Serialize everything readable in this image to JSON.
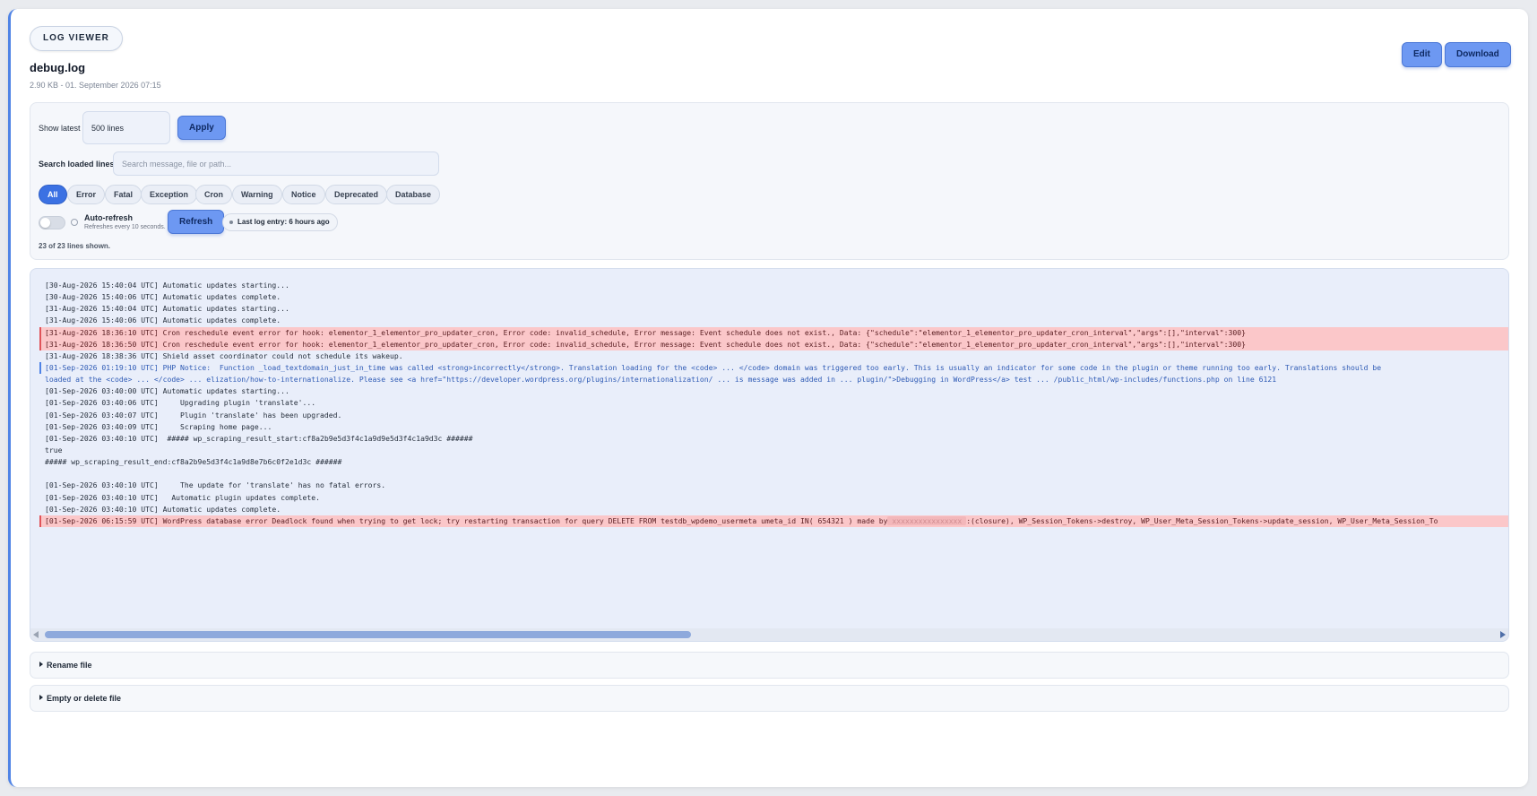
{
  "header": {
    "badge": "LOG VIEWER",
    "file_name": "debug.log",
    "file_meta": "2.90 KB - 01. September 2026 07:15",
    "edit_label": "Edit",
    "download_label": "Download"
  },
  "controls": {
    "show_latest_label": "Show latest",
    "lines_value": "500 lines",
    "apply_label": "Apply",
    "search_label": "Search loaded lines",
    "search_placeholder": "Search message, file or path...",
    "filters": [
      "All",
      "Error",
      "Fatal",
      "Exception",
      "Cron",
      "Warning",
      "Notice",
      "Deprecated",
      "Database"
    ],
    "active_filter": "All",
    "auto_refresh_label": "Auto-refresh",
    "auto_refresh_hint": "Refreshes every 10 seconds.",
    "auto_refresh_on": false,
    "refresh_label": "Refresh",
    "last_entry": "Last log entry: 6 hours ago",
    "shown_count": "23 of 23 lines shown."
  },
  "log": {
    "lines": [
      {
        "type": "normal",
        "text": "[30-Aug-2026 15:40:04 UTC] Automatic updates starting..."
      },
      {
        "type": "normal",
        "text": "[30-Aug-2026 15:40:06 UTC] Automatic updates complete."
      },
      {
        "type": "normal",
        "text": "[31-Aug-2026 15:40:04 UTC] Automatic updates starting..."
      },
      {
        "type": "normal",
        "text": "[31-Aug-2026 15:40:06 UTC] Automatic updates complete."
      },
      {
        "type": "err",
        "text": "[31-Aug-2026 18:36:10 UTC] Cron reschedule event error for hook: elementor_1_elementor_pro_updater_cron, Error code: invalid_schedule, Error message: Event schedule does not exist., Data: {\"schedule\":\"elementor_1_elementor_pro_updater_cron_interval\",\"args\":[],\"interval\":300}"
      },
      {
        "type": "err",
        "text": "[31-Aug-2026 18:36:50 UTC] Cron reschedule event error for hook: elementor_1_elementor_pro_updater_cron, Error code: invalid_schedule, Error message: Event schedule does not exist., Data: {\"schedule\":\"elementor_1_elementor_pro_updater_cron_interval\",\"args\":[],\"interval\":300}"
      },
      {
        "type": "normal",
        "text": "[31-Aug-2026 18:38:36 UTC] Shield asset coordinator could not schedule its wakeup."
      },
      {
        "type": "notice",
        "text": "[01-Sep-2026 01:19:10 UTC] PHP Notice:  Function _load_textdomain_just_in_time was called <strong>incorrectly</strong>. Translation loading for the <code> ... </code> domain was triggered too early. This is usually an indicator for some code in the plugin or theme running too early. Translations should be"
      },
      {
        "type": "notice-cont",
        "text": "loaded at the <code> ... </code> ... elization/how-to-internationalize. Please see <a href=\"https://developer.wordpress.org/plugins/internationalization/ ... is message was added in ... plugin/\">Debugging in WordPress</a> test ... /public_html/wp-includes/functions.php on line 6121"
      },
      {
        "type": "normal",
        "text": "[01-Sep-2026 03:40:00 UTC] Automatic updates starting..."
      },
      {
        "type": "normal",
        "text": "[01-Sep-2026 03:40:06 UTC]     Upgrading plugin 'translate'..."
      },
      {
        "type": "normal",
        "text": "[01-Sep-2026 03:40:07 UTC]     Plugin 'translate' has been upgraded."
      },
      {
        "type": "normal",
        "text": "[01-Sep-2026 03:40:09 UTC]     Scraping home page..."
      },
      {
        "type": "normal",
        "text": "[01-Sep-2026 03:40:10 UTC]  ##### wp_scraping_result_start:cf8a2b9e5d3f4c1a9d9e5d3f4c1a9d3c ######"
      },
      {
        "type": "normal",
        "text": "true"
      },
      {
        "type": "normal",
        "text": "##### wp_scraping_result_end:cf8a2b9e5d3f4c1a9d8e7b6c0f2e1d3c ######"
      },
      {
        "type": "normal",
        "text": ""
      },
      {
        "type": "normal",
        "text": "[01-Sep-2026 03:40:10 UTC]     The update for 'translate' has no fatal errors."
      },
      {
        "type": "normal",
        "text": "[01-Sep-2026 03:40:10 UTC]   Automatic plugin updates complete."
      },
      {
        "type": "normal",
        "text": "[01-Sep-2026 03:40:10 UTC] Automatic updates complete."
      },
      {
        "type": "err",
        "text": "[01-Sep-2026 06:15:59 UTC] WordPress database error Deadlock found when trying to get lock; try restarting transaction for query DELETE FROM testdb_wpdemo_usermeta umeta_id IN( 654321 ) made by",
        "redacted": true,
        "tail": ":(closure), WP_Session_Tokens->destroy, WP_User_Meta_Session_Tokens->update_session, WP_User_Meta_Session_To"
      }
    ]
  },
  "sections": {
    "rename": "Rename file",
    "delete": "Empty or delete file"
  }
}
